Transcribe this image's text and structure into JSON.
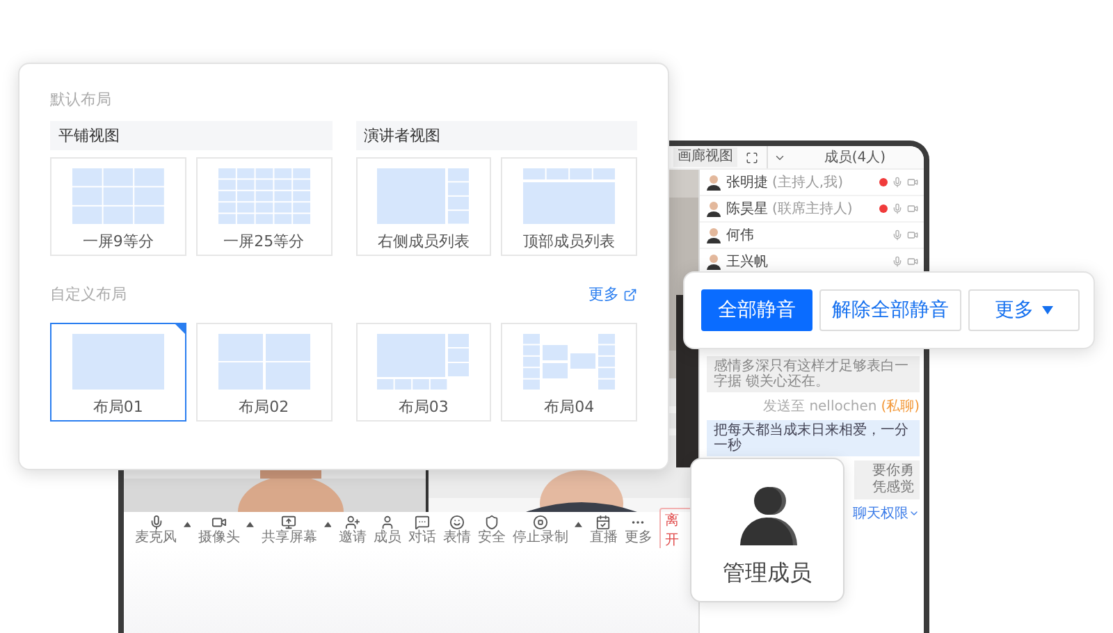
{
  "meeting_window": {
    "view_button": "画廊视图",
    "members_title": "成员(4人)",
    "members": [
      {
        "name": "张明捷",
        "role": "(主持人,我)",
        "recording": true
      },
      {
        "name": "陈昊星",
        "role": "(联席主持人)",
        "recording": true
      },
      {
        "name": "何伟",
        "recording": false
      },
      {
        "name": "王兴帆",
        "recording": false
      }
    ],
    "chat": {
      "received": "感情多深只有这样才足够表白一字据 锁关心还在。",
      "sent_to": "发送至 nellochen",
      "private_tag": "(私聊)",
      "sent": "把每天都当成末日来相爱，一分一秒",
      "received_2": [
        "要你勇",
        "凭感觉"
      ],
      "permission_link": "聊天权限"
    },
    "toolbar": [
      {
        "label": "麦克风",
        "kind": "mic",
        "has_menu": true
      },
      {
        "label": "摄像头",
        "kind": "camera",
        "has_menu": true
      },
      {
        "label": "共享屏幕",
        "kind": "share",
        "has_menu": true
      },
      {
        "label": "邀请",
        "kind": "invite",
        "has_menu": false
      },
      {
        "label": "成员",
        "kind": "members",
        "has_menu": false
      },
      {
        "label": "对话",
        "kind": "chat",
        "has_menu": false
      },
      {
        "label": "表情",
        "kind": "emoji",
        "has_menu": false
      },
      {
        "label": "安全",
        "kind": "security",
        "has_menu": false
      },
      {
        "label": "停止录制",
        "kind": "record",
        "has_menu": true
      },
      {
        "label": "直播",
        "kind": "live",
        "has_menu": false
      },
      {
        "label": "更多",
        "kind": "more",
        "has_menu": false
      }
    ],
    "leave_button": "离开"
  },
  "layout_popover": {
    "default_title": "默认布局",
    "groups": [
      {
        "title": "平铺视图",
        "options": [
          {
            "label": "一屏9等分",
            "kind": "grid3"
          },
          {
            "label": "一屏25等分",
            "kind": "grid5"
          }
        ]
      },
      {
        "title": "演讲者视图",
        "options": [
          {
            "label": "右侧成员列表",
            "kind": "right_list"
          },
          {
            "label": "顶部成员列表",
            "kind": "top_list"
          }
        ]
      }
    ],
    "custom_title": "自定义布局",
    "more_link": "更多",
    "custom_options": [
      {
        "label": "布局01",
        "kind": "single",
        "selected": true
      },
      {
        "label": "布局02",
        "kind": "quad",
        "selected": false
      },
      {
        "label": "布局03",
        "kind": "corner_list",
        "selected": false
      },
      {
        "label": "布局04",
        "kind": "wings",
        "selected": false
      }
    ]
  },
  "mute_popover": {
    "buttons": [
      {
        "label": "全部静音",
        "kind": "primary"
      },
      {
        "label": "解除全部静音",
        "kind": "secondary"
      },
      {
        "label": "更多",
        "kind": "menu"
      }
    ]
  },
  "manage_card": {
    "label": "管理成员"
  }
}
